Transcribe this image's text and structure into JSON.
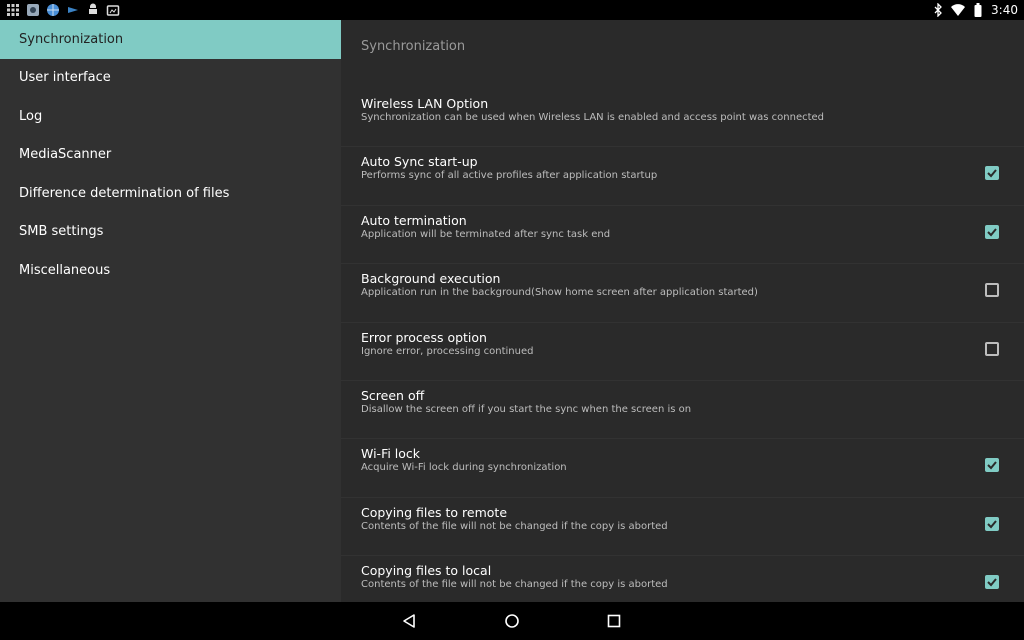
{
  "status_bar": {
    "left_icons": [
      "grid-app-icon",
      "photo-app-icon",
      "globe-app-icon",
      "sync-app-icon",
      "android-icon",
      "photo-upload-icon"
    ],
    "right_icons": [
      "bluetooth-icon",
      "wifi-icon",
      "battery-icon"
    ],
    "time": "3:40"
  },
  "sidebar": {
    "items": [
      {
        "label": "Synchronization",
        "active": true
      },
      {
        "label": "User interface"
      },
      {
        "label": "Log"
      },
      {
        "label": "MediaScanner"
      },
      {
        "label": "Difference determination of files"
      },
      {
        "label": "SMB settings"
      },
      {
        "label": "Miscellaneous"
      }
    ]
  },
  "main": {
    "title": "Synchronization",
    "prefs": [
      {
        "title": "Wireless LAN Option",
        "summary": "Synchronization can be used when Wireless LAN is enabled and access point was connected",
        "checkbox": null
      },
      {
        "title": "Auto Sync start-up",
        "summary": "Performs sync of all active profiles after application startup",
        "checkbox": true
      },
      {
        "title": "Auto termination",
        "summary": "Application will be terminated after sync task end",
        "checkbox": true
      },
      {
        "title": "Background execution",
        "summary": "Application run in the background(Show home screen after application started)",
        "checkbox": false
      },
      {
        "title": "Error process option",
        "summary": "Ignore error, processing continued",
        "checkbox": false
      },
      {
        "title": "Screen off",
        "summary": "Disallow the screen off if you start the sync when the screen is on",
        "checkbox": null
      },
      {
        "title": "Wi-Fi lock",
        "summary": "Acquire Wi-Fi lock during synchronization",
        "checkbox": true
      },
      {
        "title": "Copying files to remote",
        "summary": "Contents of the file will not be changed if the copy is aborted",
        "checkbox": true
      },
      {
        "title": "Copying files to local",
        "summary": "Contents of the file will not be changed if the copy is aborted",
        "checkbox": true
      }
    ]
  },
  "nav_bar": {
    "buttons": [
      "back-icon",
      "home-icon",
      "recents-icon"
    ]
  },
  "colors": {
    "accent": "#80cbc4",
    "sidebar_bg": "#313131",
    "main_bg": "#2a2a2a"
  }
}
